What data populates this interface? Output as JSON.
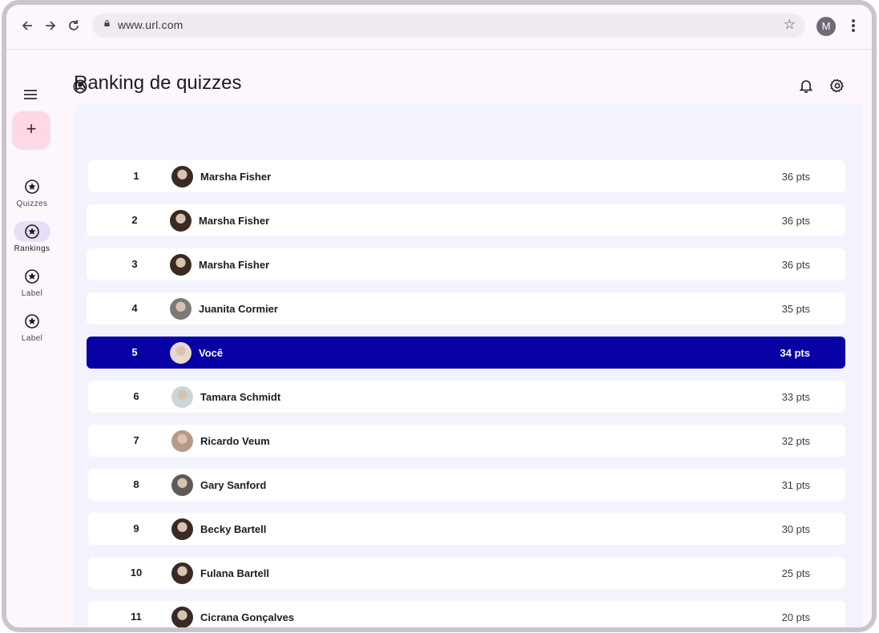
{
  "browser": {
    "url": "www.url.com",
    "profile_initial": "M"
  },
  "rail": {
    "items": [
      {
        "label": "Quizzes",
        "active": false
      },
      {
        "label": "Rankings",
        "active": true
      },
      {
        "label": "Label",
        "active": false
      },
      {
        "label": "Label",
        "active": false
      }
    ]
  },
  "page": {
    "title": "Ranking de quizzes"
  },
  "ranking": [
    {
      "rank": "1",
      "name": "Marsha Fisher",
      "points": "36 pts",
      "avatar_color": "#3a2a22"
    },
    {
      "rank": "2",
      "name": "Marsha Fisher",
      "points": "36 pts",
      "avatar_color": "#3a2a22"
    },
    {
      "rank": "3",
      "name": "Marsha Fisher",
      "points": "36 pts",
      "avatar_color": "#3a2a22"
    },
    {
      "rank": "4",
      "name": "Juanita Cormier",
      "points": "35 pts",
      "avatar_color": "#7c7a78"
    },
    {
      "rank": "5",
      "name": "Você",
      "points": "34 pts",
      "avatar_color": "#e8d9cc",
      "highlight": true
    },
    {
      "rank": "6",
      "name": "Tamara Schmidt",
      "points": "33 pts",
      "avatar_color": "#c9d6dc"
    },
    {
      "rank": "7",
      "name": "Ricardo Veum",
      "points": "32 pts",
      "avatar_color": "#b79a86"
    },
    {
      "rank": "8",
      "name": "Gary Sanford",
      "points": "31 pts",
      "avatar_color": "#5d5a57"
    },
    {
      "rank": "9",
      "name": "Becky Bartell",
      "points": "30 pts",
      "avatar_color": "#3a2a24"
    },
    {
      "rank": "10",
      "name": "Fulana Bartell",
      "points": "25 pts",
      "avatar_color": "#3a2a24"
    },
    {
      "rank": "11",
      "name": "Cicrana Gonçalves",
      "points": "20 pts",
      "avatar_color": "#3a2a24"
    }
  ],
  "colors": {
    "highlight_row": "#0600a5",
    "fab": "#ffd8e4",
    "rail_active": "#e8def8"
  },
  "icons": {
    "back": "arrow-back-icon",
    "forward": "arrow-forward-icon",
    "reload": "reload-icon",
    "lock": "lock-icon",
    "bookmark": "star-icon",
    "menu": "hamburger-icon",
    "add": "plus-icon",
    "nav": "star-circle-icon",
    "account": "account-circle-icon",
    "notifications": "bell-icon",
    "settings": "gear-icon"
  }
}
